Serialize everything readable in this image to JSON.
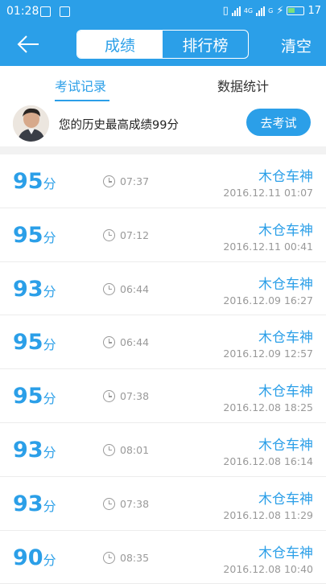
{
  "status_bar": {
    "time": "01:28",
    "battery": "17",
    "network": "4G",
    "sim2": "G"
  },
  "header": {
    "segments": [
      {
        "label": "成绩",
        "active": true
      },
      {
        "label": "排行榜",
        "active": false
      }
    ],
    "clear_label": "清空"
  },
  "tabs": [
    {
      "label": "考试记录",
      "active": true
    },
    {
      "label": "数据统计",
      "active": false
    }
  ],
  "best": {
    "text": "您的历史最高成绩99分",
    "button_label": "去考试"
  },
  "records": [
    {
      "score": "95",
      "unit": "分",
      "duration": "07:37",
      "name": "木仓车神",
      "date": "2016.12.11  01:07"
    },
    {
      "score": "95",
      "unit": "分",
      "duration": "07:12",
      "name": "木仓车神",
      "date": "2016.12.11  00:41"
    },
    {
      "score": "93",
      "unit": "分",
      "duration": "06:44",
      "name": "木仓车神",
      "date": "2016.12.09  16:27"
    },
    {
      "score": "95",
      "unit": "分",
      "duration": "06:44",
      "name": "木仓车神",
      "date": "2016.12.09  12:57"
    },
    {
      "score": "95",
      "unit": "分",
      "duration": "07:38",
      "name": "木仓车神",
      "date": "2016.12.08  18:25"
    },
    {
      "score": "93",
      "unit": "分",
      "duration": "08:01",
      "name": "木仓车神",
      "date": "2016.12.08  16:14"
    },
    {
      "score": "93",
      "unit": "分",
      "duration": "07:38",
      "name": "木仓车神",
      "date": "2016.12.08  11:29"
    },
    {
      "score": "90",
      "unit": "分",
      "duration": "08:35",
      "name": "木仓车神",
      "date": "2016.12.08  10:40"
    }
  ],
  "colors": {
    "accent": "#2b9fe8",
    "muted": "#999999"
  }
}
